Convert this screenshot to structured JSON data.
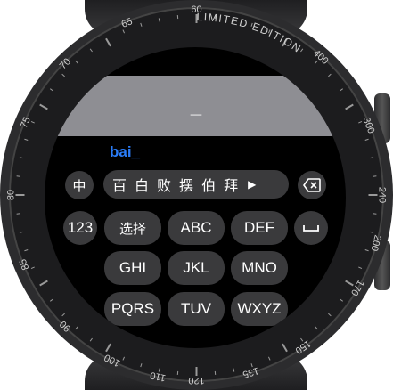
{
  "bezel": {
    "brand_text": "LIMITED EDITION",
    "ticks": [
      "60",
      "65",
      "70",
      "75",
      "80",
      "85",
      "90",
      "100",
      "110",
      "120",
      "135",
      "150",
      "170",
      "200",
      "240",
      "300",
      "400"
    ]
  },
  "input": {
    "text": "_",
    "composing": "bai_"
  },
  "candidates": {
    "items": [
      "百",
      "白",
      "败",
      "摆",
      "伯",
      "拜"
    ],
    "more_icon": "play-right-icon"
  },
  "keys": {
    "lang": "中",
    "delete_icon": "backspace-icon",
    "num": "123",
    "select": "选择",
    "abc": "ABC",
    "def": "DEF",
    "space_icon": "space-icon",
    "ghi": "GHI",
    "jkl": "JKL",
    "mno": "MNO",
    "pqrs": "PQRS",
    "tuv": "TUV",
    "wxyz": "WXYZ"
  },
  "colors": {
    "accent": "#2a7cf6",
    "key_bg": "#3a3a3c",
    "input_bar": "#8e8e93"
  }
}
